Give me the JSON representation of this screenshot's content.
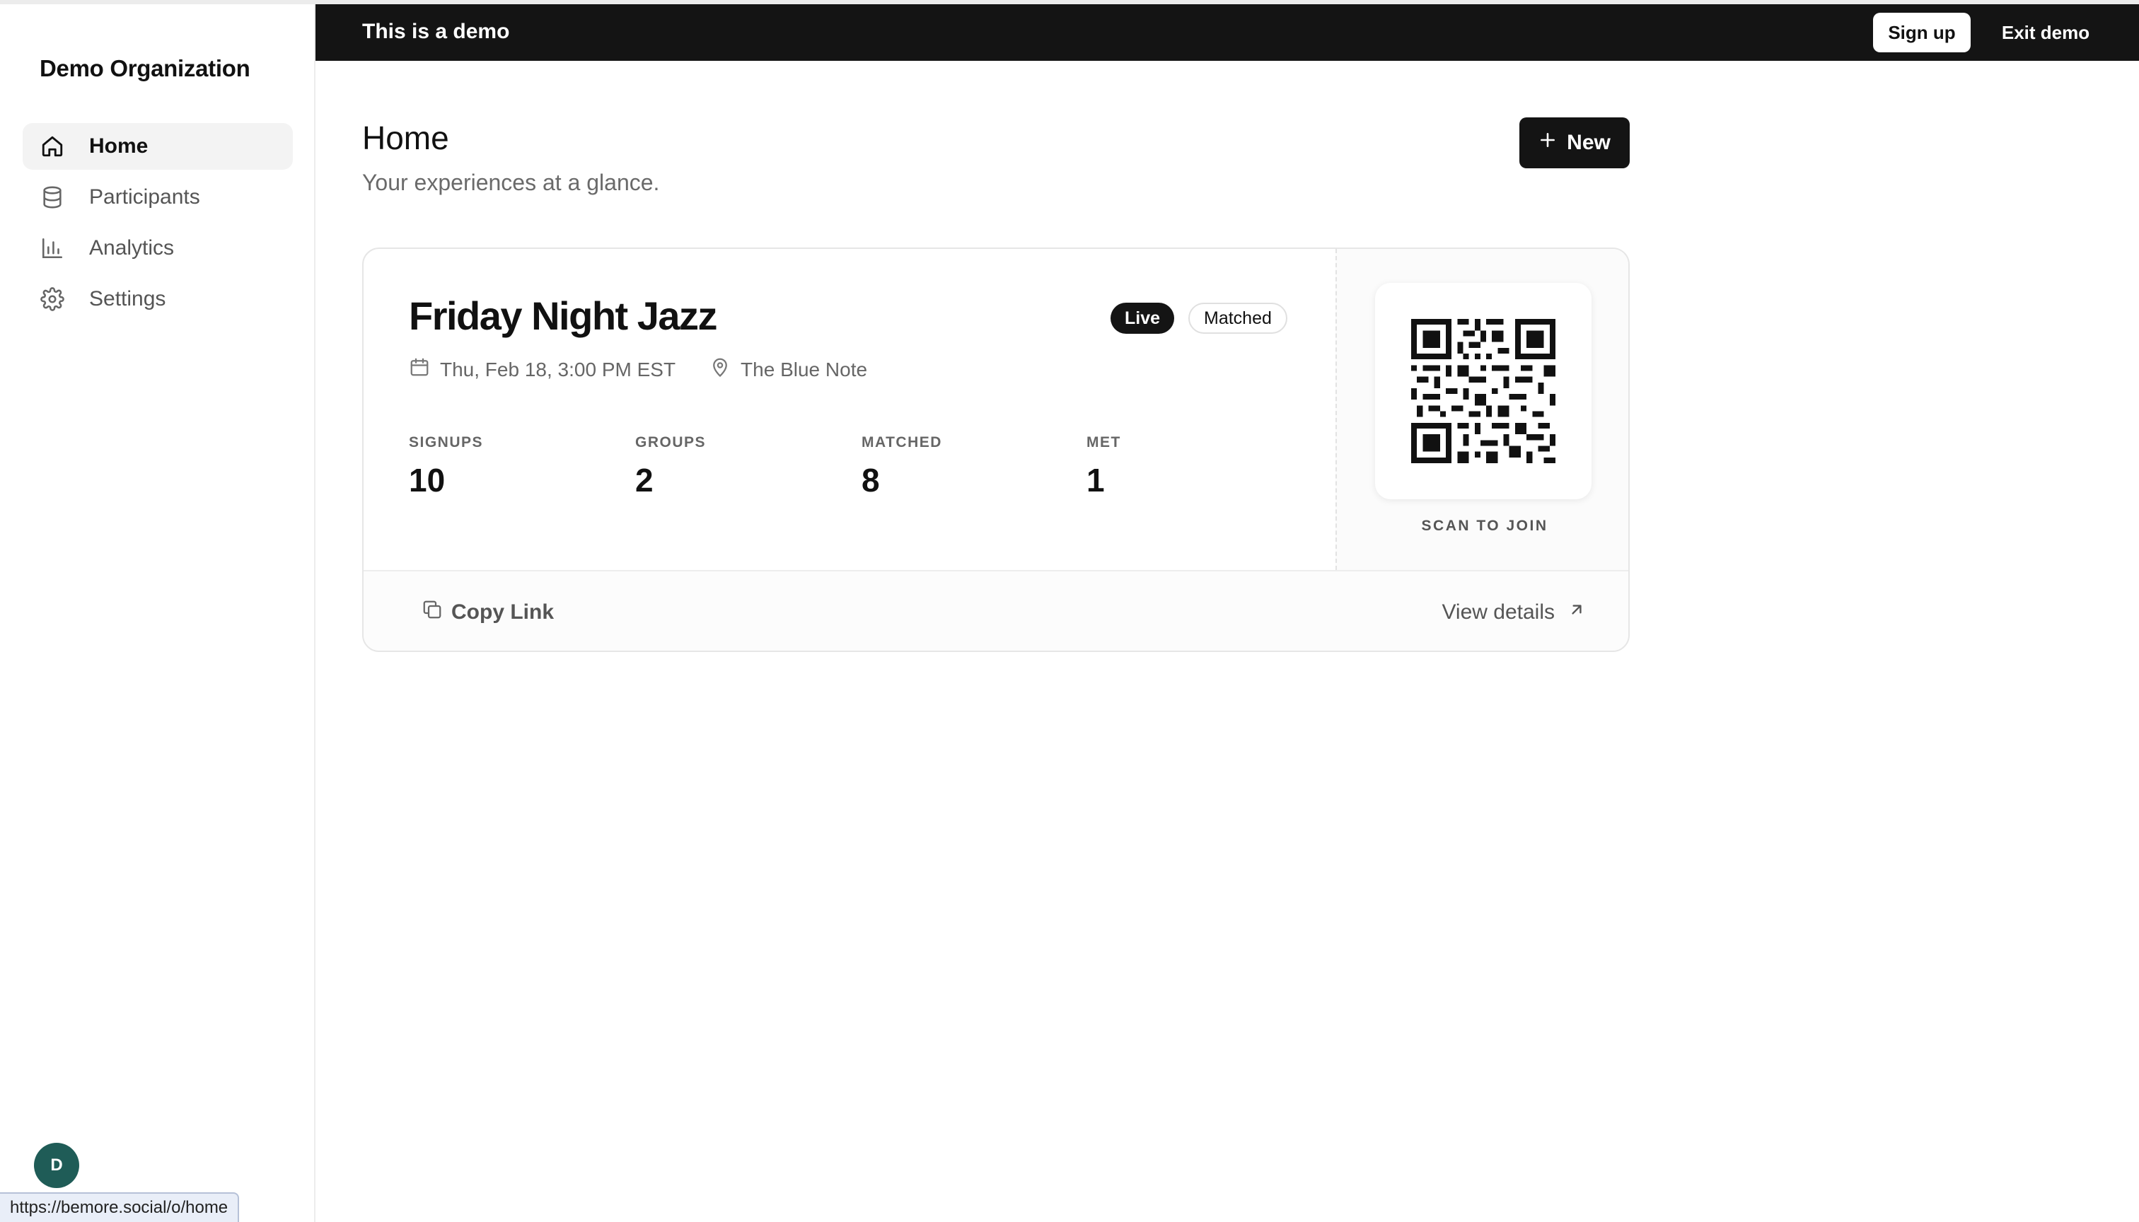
{
  "sidebar": {
    "org_name": "Demo Organization",
    "items": [
      {
        "label": "Home",
        "icon": "home-icon",
        "active": true
      },
      {
        "label": "Participants",
        "icon": "database-icon",
        "active": false
      },
      {
        "label": "Analytics",
        "icon": "bar-chart-icon",
        "active": false
      },
      {
        "label": "Settings",
        "icon": "gear-icon",
        "active": false
      }
    ],
    "avatar_initial": "D",
    "status_url": "https://bemore.social/o/home"
  },
  "demo_bar": {
    "text": "This is a demo",
    "signup_label": "Sign up",
    "exit_label": "Exit demo"
  },
  "page": {
    "title": "Home",
    "subtitle": "Your experiences at a glance.",
    "new_label": "New"
  },
  "event": {
    "title": "Friday Night Jazz",
    "badges": [
      "Live",
      "Matched"
    ],
    "date": "Thu, Feb 18, 3:00 PM EST",
    "location": "The Blue Note",
    "stats": [
      {
        "label": "SIGNUPS",
        "value": "10"
      },
      {
        "label": "GROUPS",
        "value": "2"
      },
      {
        "label": "MATCHED",
        "value": "8"
      },
      {
        "label": "MET",
        "value": "1"
      }
    ],
    "scan_label": "SCAN TO JOIN",
    "copy_link_label": "Copy Link",
    "view_details_label": "View details"
  },
  "colors": {
    "dark": "#141414",
    "avatar": "#1f5c57",
    "muted_text": "#666666"
  }
}
